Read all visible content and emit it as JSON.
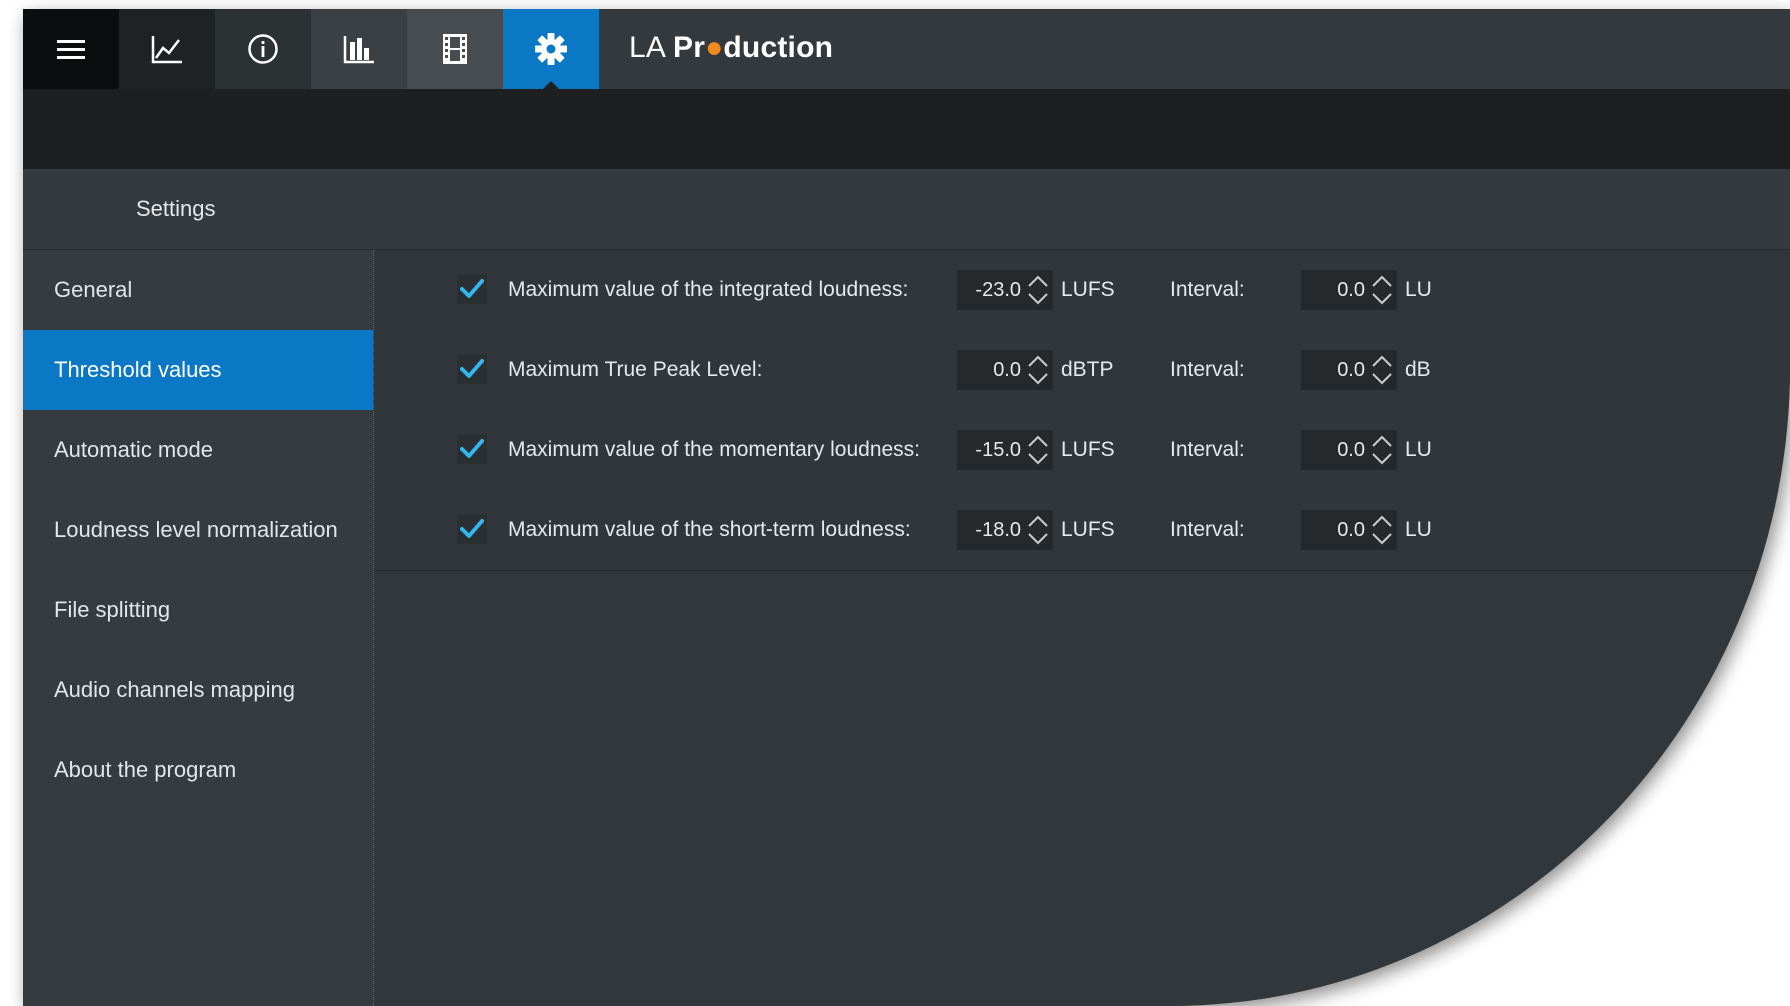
{
  "app": {
    "title_part1": "LA ",
    "title_part2a": "Pr",
    "title_part2b": "duction"
  },
  "toolbar": {
    "buttons": [
      {
        "icon": "hamburger-menu-icon"
      },
      {
        "icon": "line-chart-icon"
      },
      {
        "icon": "info-icon"
      },
      {
        "icon": "bar-chart-icon"
      },
      {
        "icon": "film-strip-icon"
      },
      {
        "icon": "gear-icon",
        "active": true
      }
    ]
  },
  "settings": {
    "header": "Settings"
  },
  "sidebar": {
    "items": [
      {
        "label": "General"
      },
      {
        "label": "Threshold values",
        "active": true
      },
      {
        "label": "Automatic mode"
      },
      {
        "label": "Loudness level normalization"
      },
      {
        "label": "File splitting"
      },
      {
        "label": "Audio channels mapping"
      },
      {
        "label": "About the program"
      }
    ]
  },
  "thresholds": {
    "interval_label": "Interval:",
    "rows": [
      {
        "checked": true,
        "label": "Maximum value of the integrated loudness:",
        "value": "-23.0",
        "unit": "LUFS",
        "interval": "0.0",
        "interval_unit": "LU"
      },
      {
        "checked": true,
        "label": "Maximum True Peak Level:",
        "value": "0.0",
        "unit": "dBTP",
        "interval": "0.0",
        "interval_unit": "dB"
      },
      {
        "checked": true,
        "label": "Maximum value of the momentary loudness:",
        "value": "-15.0",
        "unit": "LUFS",
        "interval": "0.0",
        "interval_unit": "LU"
      },
      {
        "checked": true,
        "label": "Maximum value of the short-term loudness:",
        "value": "-18.0",
        "unit": "LUFS",
        "interval": "0.0",
        "interval_unit": "LU"
      }
    ]
  },
  "colors": {
    "accent": "#0a78c4",
    "check": "#35b6ee",
    "logo_dot": "#f08a1c"
  }
}
